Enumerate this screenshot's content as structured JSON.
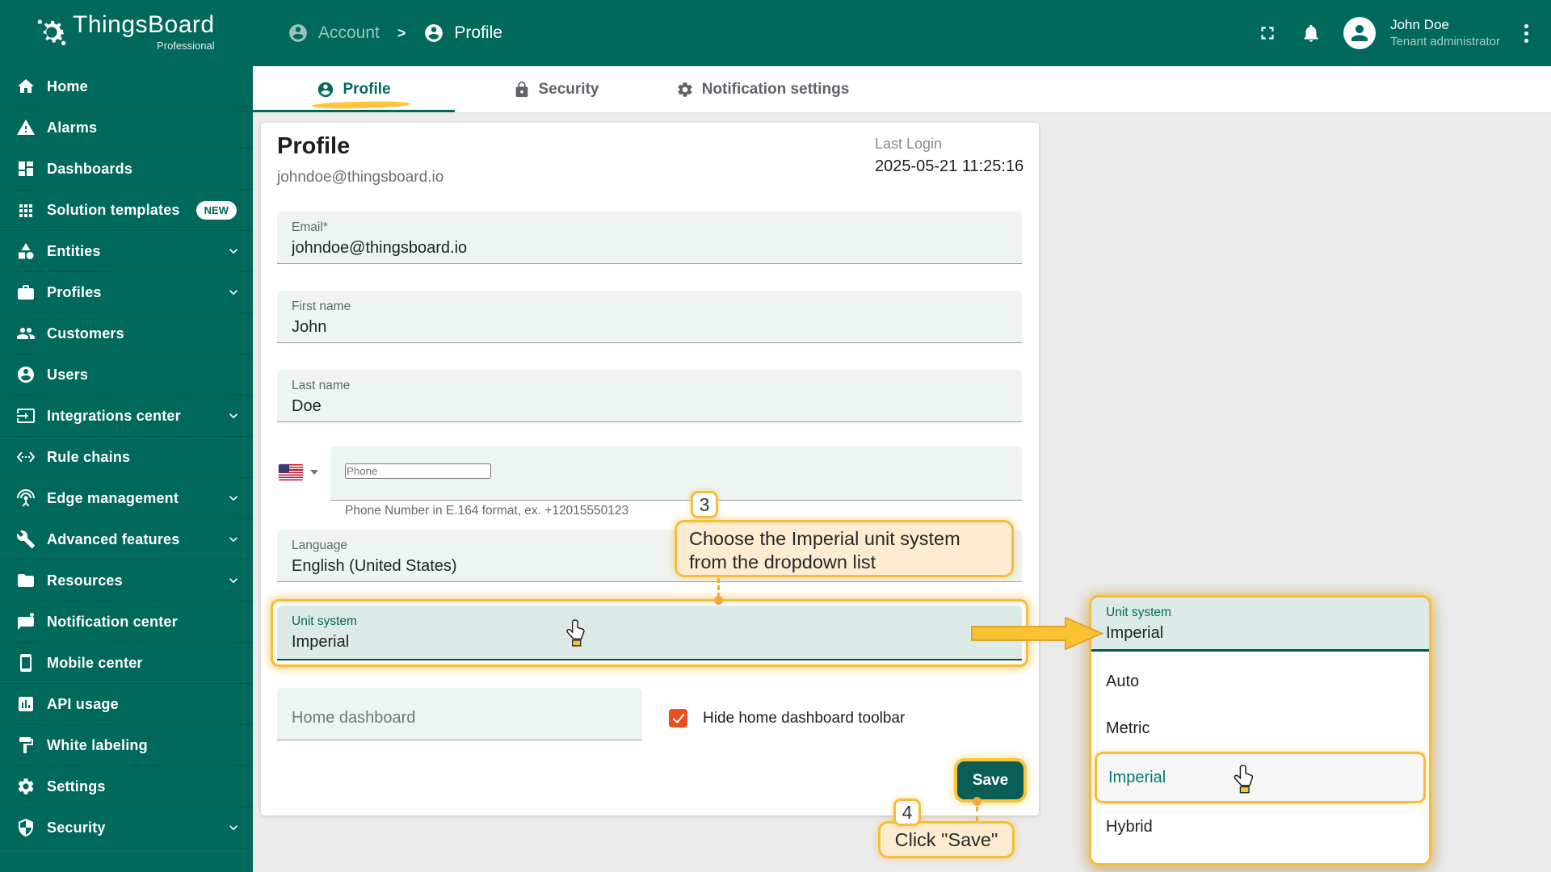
{
  "app": {
    "name": "ThingsBoard",
    "edition": "Professional"
  },
  "header": {
    "breadcrumb": {
      "parent": "Account",
      "separator": ">",
      "current": "Profile"
    },
    "user": {
      "name": "John Doe",
      "role": "Tenant administrator"
    }
  },
  "sidebar": {
    "items": [
      {
        "label": "Home"
      },
      {
        "label": "Alarms"
      },
      {
        "label": "Dashboards"
      },
      {
        "label": "Solution templates",
        "badge": "NEW"
      },
      {
        "label": "Entities",
        "expandable": true
      },
      {
        "label": "Profiles",
        "expandable": true
      },
      {
        "label": "Customers"
      },
      {
        "label": "Users"
      },
      {
        "label": "Integrations center",
        "expandable": true
      },
      {
        "label": "Rule chains"
      },
      {
        "label": "Edge management",
        "expandable": true
      },
      {
        "label": "Advanced features",
        "expandable": true
      },
      {
        "label": "Resources",
        "expandable": true
      },
      {
        "label": "Notification center"
      },
      {
        "label": "Mobile center"
      },
      {
        "label": "API usage"
      },
      {
        "label": "White labeling"
      },
      {
        "label": "Settings"
      },
      {
        "label": "Security",
        "expandable": true
      }
    ]
  },
  "tabs": {
    "profile": "Profile",
    "security": "Security",
    "notification_settings": "Notification settings"
  },
  "page": {
    "title": "Profile",
    "subtitle": "johndoe@thingsboard.io",
    "last_login_label": "Last Login",
    "last_login_value": "2025-05-21 11:25:16"
  },
  "form": {
    "email": {
      "label": "Email*",
      "value": "johndoe@thingsboard.io"
    },
    "first_name": {
      "label": "First name",
      "value": "John"
    },
    "last_name": {
      "label": "Last name",
      "value": "Doe"
    },
    "phone": {
      "placeholder": "Phone",
      "hint": "Phone Number in E.164 format, ex. +12015550123",
      "country": "US"
    },
    "language": {
      "label": "Language",
      "value": "English (United States)"
    },
    "unit_system": {
      "label": "Unit system",
      "value": "Imperial"
    },
    "home_dashboard": {
      "placeholder": "Home dashboard"
    },
    "hide_home_dashboard_toolbar": {
      "label": "Hide home dashboard toolbar",
      "checked": true
    },
    "save_label": "Save"
  },
  "tutorial": {
    "step3": {
      "number": "3",
      "text": "Choose the Imperial unit system from the dropdown list"
    },
    "step4": {
      "number": "4",
      "text": "Click \"Save\""
    }
  },
  "unit_dropdown": {
    "label": "Unit system",
    "value": "Imperial",
    "options": [
      {
        "label": "Auto"
      },
      {
        "label": "Metric"
      },
      {
        "label": "Imperial",
        "selected": true
      },
      {
        "label": "Hybrid"
      }
    ]
  },
  "colors": {
    "brand": "#00695c",
    "highlight": "#f8bc3b",
    "checkbox": "#e8501f"
  }
}
